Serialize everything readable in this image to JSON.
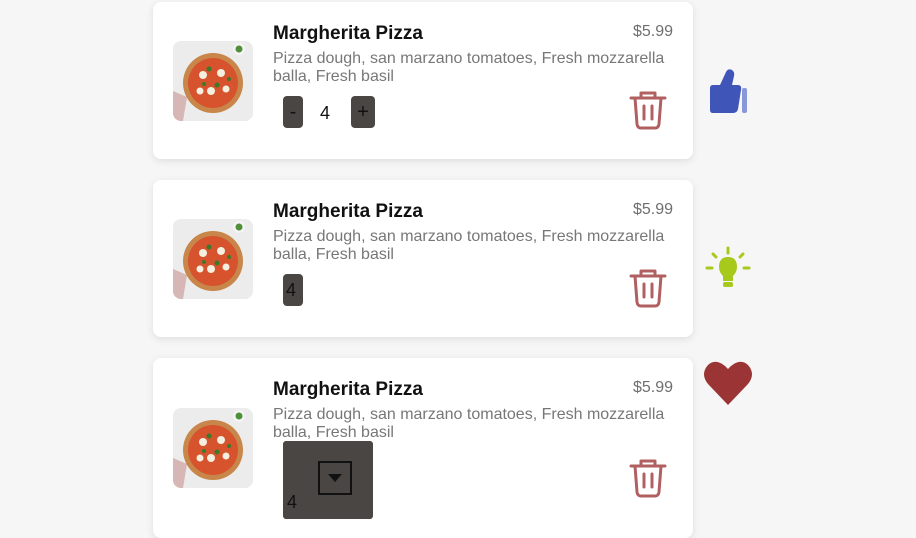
{
  "colors": {
    "trash": "#b06060",
    "thumbs_up": "#3f55b8",
    "bulb": "#a7c91b",
    "heart": "#9b3434",
    "control_bg": "#4a4644"
  },
  "cards": [
    {
      "title": "Margherita Pizza",
      "price": "$5.99",
      "description": "Pizza dough, san marzano tomatoes, Fresh mozzarella balla, Fresh basil",
      "quantity": "4",
      "control": "stepper",
      "minus_label": "-",
      "plus_label": "+",
      "icon": "trash-icon"
    },
    {
      "title": "Margherita Pizza",
      "price": "$5.99",
      "description": "Pizza dough, san marzano tomatoes, Fresh mozzarella balla, Fresh basil",
      "quantity": "4",
      "control": "input",
      "icon": "trash-icon"
    },
    {
      "title": "Margherita Pizza",
      "price": "$5.99",
      "description": "Pizza dough, san marzano tomatoes, Fresh mozzarella balla, Fresh basil",
      "quantity": "4",
      "control": "select",
      "icon": "trash-icon"
    }
  ],
  "side_icons": [
    "thumbs-up-icon",
    "lightbulb-icon",
    "heart-icon"
  ]
}
